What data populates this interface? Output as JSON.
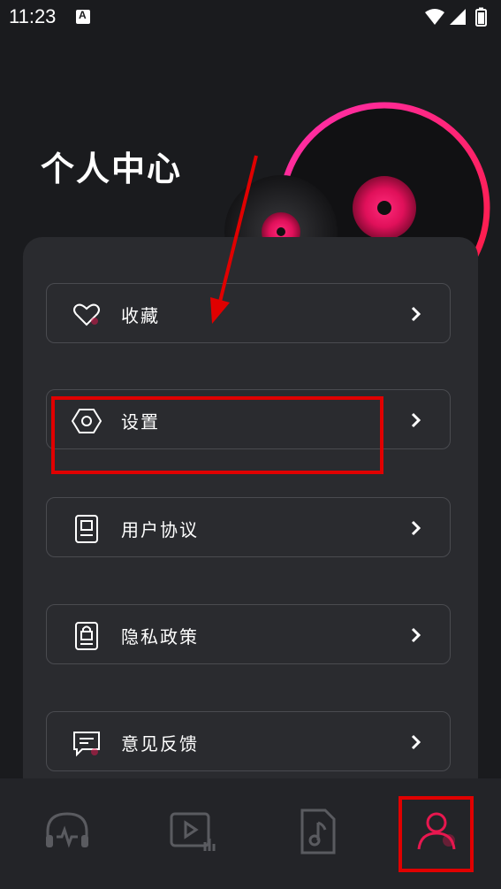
{
  "status_bar": {
    "time": "11:23"
  },
  "page": {
    "title": "个人中心"
  },
  "menu": {
    "items": [
      {
        "label": "收藏",
        "icon": "heart-icon"
      },
      {
        "label": "设置",
        "icon": "hexagon-nut-icon"
      },
      {
        "label": "用户协议",
        "icon": "agreement-doc-icon"
      },
      {
        "label": "隐私政策",
        "icon": "privacy-lock-doc-icon"
      },
      {
        "label": "意见反馈",
        "icon": "feedback-chat-icon"
      }
    ]
  },
  "tab_bar": {
    "tabs": [
      {
        "name": "listen",
        "icon": "headphones-icon",
        "active": false
      },
      {
        "name": "video",
        "icon": "video-play-icon",
        "active": false
      },
      {
        "name": "music",
        "icon": "music-file-icon",
        "active": false
      },
      {
        "name": "profile",
        "icon": "user-icon",
        "active": true
      }
    ]
  },
  "colors": {
    "accent": "#e8174f",
    "annotation_red": "#e00000",
    "card_bg": "#2a2b2f"
  }
}
